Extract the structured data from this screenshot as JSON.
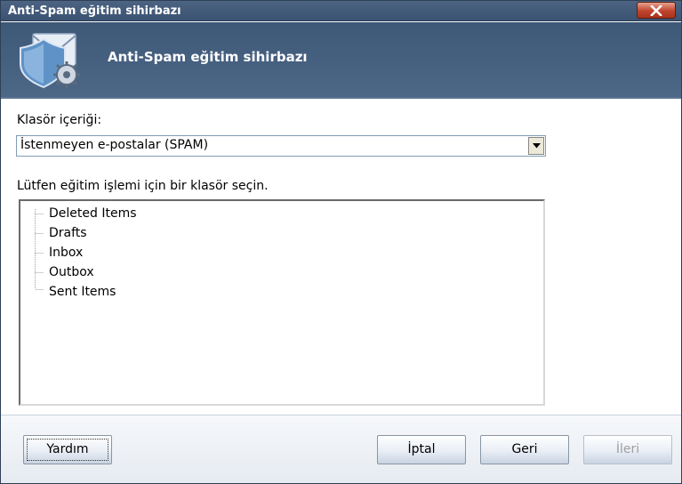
{
  "window": {
    "title": "Anti-Spam eğitim sihirbazı",
    "close_glyph": "X"
  },
  "header": {
    "title": "Anti-Spam eğitim sihirbazı",
    "icon": "anti-spam-shield-envelope-icon"
  },
  "folder_content": {
    "label": "Klasör içeriği:",
    "selected": "İstenmeyen e-postalar (SPAM)"
  },
  "folder_select": {
    "label": "Lütfen eğitim işlemi için bir klasör seçin.",
    "items": [
      "Deleted Items",
      "Drafts",
      "Inbox",
      "Outbox",
      "Sent Items"
    ]
  },
  "buttons": {
    "help": "Yardım",
    "cancel": "İptal",
    "back": "Geri",
    "next": "İleri"
  },
  "colors": {
    "titlebar": "#3b5372",
    "header": "#4d6787",
    "close": "#c0442c"
  }
}
